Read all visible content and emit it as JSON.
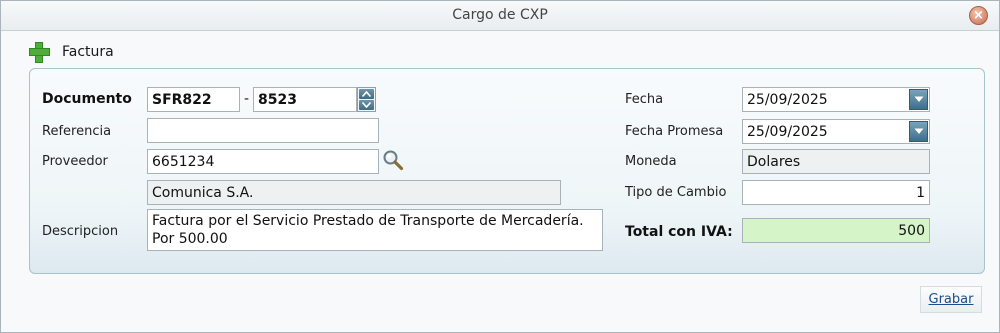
{
  "window": {
    "title": "Cargo de CXP"
  },
  "section": {
    "label": "Factura"
  },
  "form": {
    "documento": {
      "label": "Documento",
      "prefix": "SFR822",
      "separator": "-",
      "number": "8523"
    },
    "referencia": {
      "label": "Referencia",
      "value": ""
    },
    "proveedor": {
      "label": "Proveedor",
      "code": "6651234",
      "name": "Comunica S.A."
    },
    "descripcion": {
      "label": "Descripcion",
      "value": "Factura por el Servicio Prestado de Transporte de Mercadería. Por 500.00"
    },
    "fecha": {
      "label": "Fecha",
      "value": "25/09/2025"
    },
    "fecha_promesa": {
      "label": "Fecha Promesa",
      "value": "25/09/2025"
    },
    "moneda": {
      "label": "Moneda",
      "value": "Dolares"
    },
    "tipo_cambio": {
      "label": "Tipo de Cambio",
      "value": "1"
    },
    "total": {
      "label": "Total con IVA:",
      "value": "500"
    }
  },
  "actions": {
    "save_label": "Grabar"
  },
  "icons": {
    "close": "close-icon",
    "add": "plus-icon",
    "search": "search-icon",
    "spinner": "spinner-icon",
    "dropdown": "chevron-down-icon"
  },
  "colors": {
    "total_bg": "#d5f5c9",
    "accent": "#3f6e8a",
    "add_icon": "#4fae3a",
    "close_icon": "#d4866b"
  }
}
